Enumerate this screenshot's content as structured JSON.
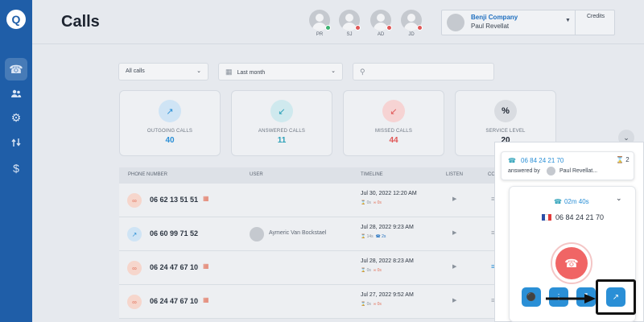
{
  "sidebar": {
    "logo": "Q",
    "items": [
      {
        "icon": "phone-icon",
        "active": true
      },
      {
        "icon": "users-icon",
        "active": false
      },
      {
        "icon": "gear-icon",
        "active": false
      },
      {
        "icon": "routing-icon",
        "active": false
      },
      {
        "icon": "dollar-icon",
        "active": false
      }
    ]
  },
  "header": {
    "title": "Calls",
    "agents": [
      {
        "initials": "PR",
        "status_color": "#3cb371"
      },
      {
        "initials": "SJ",
        "status_color": "#e05757"
      },
      {
        "initials": "AD",
        "status_color": "#e05757"
      },
      {
        "initials": "JD",
        "status_color": "#e05757"
      }
    ],
    "company": "Benji Company",
    "user": "Paul Revellat",
    "credits_label": "Credits"
  },
  "filters": {
    "calls_filter": "All calls",
    "date_filter": "Last month",
    "search_placeholder": ""
  },
  "stats": [
    {
      "label": "OUTGOING CALLS",
      "value": "40",
      "color": "#2a8fd6",
      "bg": "#cfe4f5"
    },
    {
      "label": "ANSWERED CALLS",
      "value": "11",
      "color": "#2aa0b8",
      "bg": "#cfe9ee"
    },
    {
      "label": "MISSED CALLS",
      "value": "44",
      "color": "#e05757",
      "bg": "#f6d3d3"
    },
    {
      "label": "SERVICE LEVEL",
      "value": "20",
      "color": "#1d2430",
      "bg": "#d9dce1",
      "symbol": "%"
    }
  ],
  "table": {
    "headers": {
      "phone": "PHONE NUMBER",
      "user": "USER",
      "timeline": "TIMELINE",
      "listen": "LISTEN",
      "comment": "COMM"
    },
    "rows": [
      {
        "number": "06 62 13 51 51",
        "type": "missed",
        "user": "",
        "date": "Jul 30, 2022 12:20 AM",
        "wait": "0s",
        "talk": "0s"
      },
      {
        "number": "06 60 99 71 52",
        "type": "outgoing",
        "user": "Aymeric Van Bockstael",
        "date": "Jul 28, 2022 9:23 AM",
        "wait": "14s",
        "talk": "2s"
      },
      {
        "number": "06 24 47 67 10",
        "type": "missed",
        "user": "",
        "date": "Jul 28, 2022 8:23 AM",
        "wait": "0s",
        "talk": "0s"
      },
      {
        "number": "06 24 47 67 10",
        "type": "missed",
        "user": "",
        "date": "Jul 27, 2022 9:52 AM",
        "wait": "0s",
        "talk": "0s"
      }
    ]
  },
  "call_panel": {
    "notification": {
      "number": "06 84 24 21 70",
      "answered_by_label": "answered by",
      "answered_by_name": "Paul Revellat...",
      "count": "2"
    },
    "active_call": {
      "timer": "02m 40s",
      "number": "06 84 24 21 70"
    }
  }
}
